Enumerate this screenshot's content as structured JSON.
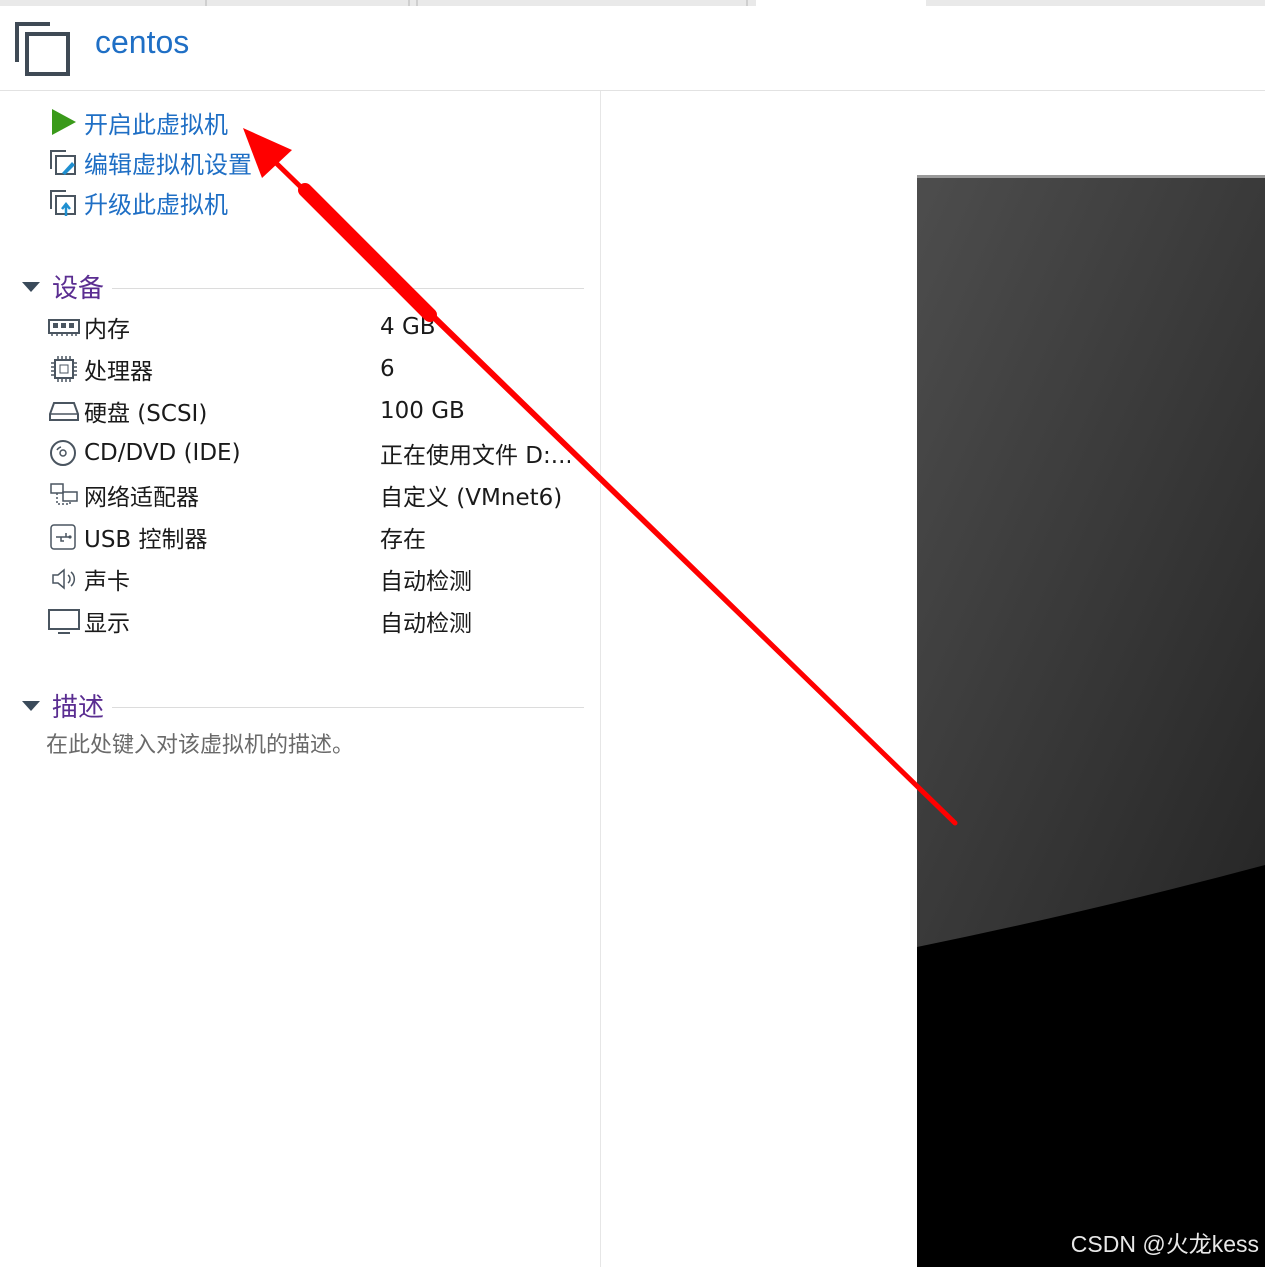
{
  "vm": {
    "name": "centos"
  },
  "actions": [
    {
      "label": "开启此虚拟机",
      "icon": "play-icon"
    },
    {
      "label": "编辑虚拟机设置",
      "icon": "edit-settings-icon"
    },
    {
      "label": "升级此虚拟机",
      "icon": "upgrade-icon"
    }
  ],
  "devices": {
    "title": "设备",
    "items": [
      {
        "name": "内存",
        "value": "4 GB",
        "icon": "memory-icon"
      },
      {
        "name": "处理器",
        "value": "6",
        "icon": "cpu-icon"
      },
      {
        "name": "硬盘 (SCSI)",
        "value": "100 GB",
        "icon": "hard-disk-icon"
      },
      {
        "name": "CD/DVD (IDE)",
        "value": "正在使用文件 D:...",
        "icon": "cd-dvd-icon"
      },
      {
        "name": "网络适配器",
        "value": "自定义 (VMnet6)",
        "icon": "network-adapter-icon"
      },
      {
        "name": "USB 控制器",
        "value": "存在",
        "icon": "usb-icon"
      },
      {
        "name": "声卡",
        "value": "自动检测",
        "icon": "speaker-icon"
      },
      {
        "name": "显示",
        "value": "自动检测",
        "icon": "display-icon"
      }
    ]
  },
  "description": {
    "title": "描述",
    "placeholder": "在此处键入对该虚拟机的描述。"
  },
  "watermark": "CSDN @火龙kess",
  "colors": {
    "link": "#1f6fc5",
    "section": "#5a2d91",
    "annotation": "#ff0000",
    "play": "#3a9a1a"
  }
}
